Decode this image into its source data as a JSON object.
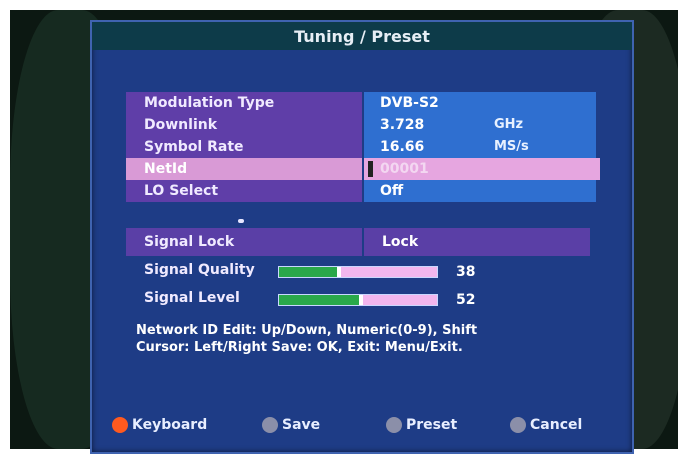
{
  "title": "Tuning / Preset",
  "fields": [
    {
      "label": "Modulation Type",
      "value": "DVB-S2",
      "unit": ""
    },
    {
      "label": "Downlink",
      "value": "3.728",
      "unit": "GHz"
    },
    {
      "label": "Symbol Rate",
      "value": "16.66",
      "unit": "MS/s"
    },
    {
      "label": "NetId",
      "value": "00001",
      "unit": "",
      "selected": true
    },
    {
      "label": "LO Select",
      "value": "Off",
      "unit": ""
    }
  ],
  "signal_lock": {
    "label": "Signal Lock",
    "value": "Lock"
  },
  "signal_quality": {
    "label": "Signal Quality",
    "value": 38
  },
  "signal_level": {
    "label": "Signal Level",
    "value": 52
  },
  "help_text": {
    "line1": "Network ID Edit: Up/Down, Numeric(0-9), Shift",
    "line2": "Cursor: Left/Right Save: OK, Exit: Menu/Exit."
  },
  "buttons": {
    "keyboard": {
      "label": "Keyboard",
      "color": "#ff5a1f",
      "icon": "red-circle-icon"
    },
    "save": {
      "label": "Save",
      "color": "#8b8fa9",
      "icon": "gray-circle-icon"
    },
    "preset": {
      "label": "Preset",
      "color": "#8b8fa9",
      "icon": "gray-circle-icon"
    },
    "cancel": {
      "label": "Cancel",
      "color": "#8b8fa9",
      "icon": "gray-circle-icon"
    }
  },
  "colors": {
    "panel": "#1e3c86",
    "label_bg": "#5f3ea8",
    "value_bg": "#2f6fd0",
    "selected_bg": "#e6a6e0",
    "meter_fill": "#2aa84a"
  }
}
